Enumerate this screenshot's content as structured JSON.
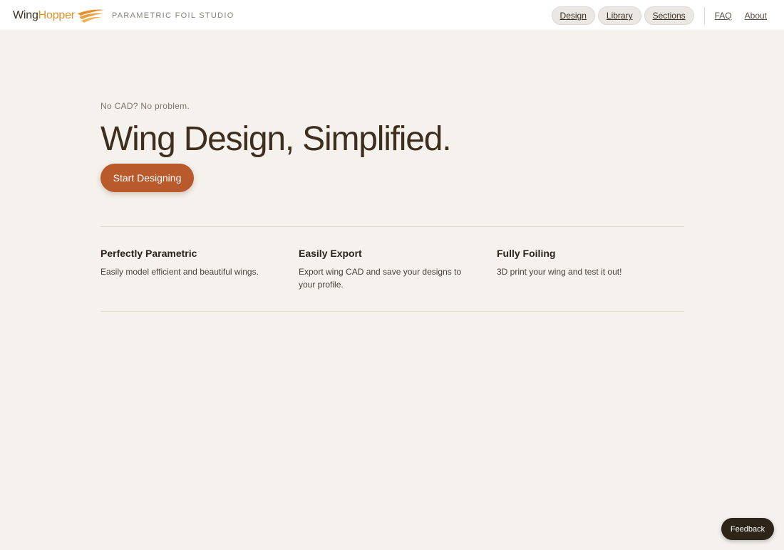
{
  "header": {
    "brand_prefix": "Wing",
    "brand_suffix": "Hopper",
    "logo_icon": "wing-swoosh-icon",
    "tagline": "PARAMETRIC FOIL STUDIO",
    "nav_pills": [
      {
        "label": "Design"
      },
      {
        "label": "Library"
      },
      {
        "label": "Sections"
      }
    ],
    "nav_links": [
      {
        "label": "FAQ"
      },
      {
        "label": "About"
      }
    ]
  },
  "hero": {
    "eyebrow": "No CAD? No problem.",
    "headline": "Wing Design, Simplified.",
    "cta_label": "Start Designing"
  },
  "features": [
    {
      "title": "Perfectly Parametric",
      "description": "Easily model efficient and beautiful wings."
    },
    {
      "title": "Easily Export",
      "description": "Export wing CAD and save your designs to your profile."
    },
    {
      "title": "Fully Foiling",
      "description": "3D print your wing and test it out!"
    }
  ],
  "feedback_label": "Feedback",
  "colors": {
    "background": "#f5f2ee",
    "accent_orange": "#e3912a",
    "cta_rust": "#b85a2c",
    "feedback_dark": "#2e2519"
  }
}
